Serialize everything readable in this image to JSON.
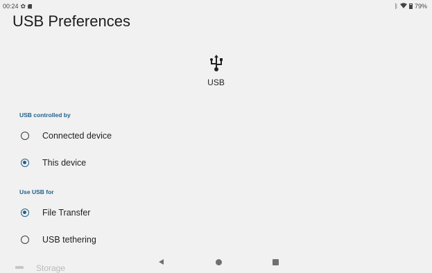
{
  "status": {
    "time": "00:24",
    "battery_percent": "79%",
    "icons_left": [
      "gear-icon",
      "sdcard-icon"
    ],
    "icons_right": [
      "bluetooth-icon",
      "wifi-icon",
      "battery-icon"
    ]
  },
  "page": {
    "title": "USB Preferences"
  },
  "header": {
    "icon": "usb-icon",
    "label": "USB"
  },
  "sections": {
    "controlled_by": {
      "label": "USB controlled by",
      "options": [
        {
          "label": "Connected device",
          "checked": false
        },
        {
          "label": "This device",
          "checked": true
        }
      ]
    },
    "use_for": {
      "label": "Use USB for",
      "options": [
        {
          "label": "File Transfer",
          "checked": true
        },
        {
          "label": "USB tethering",
          "checked": false
        }
      ]
    }
  },
  "partial_item": {
    "label": "Storage"
  },
  "colors": {
    "accent": "#1f5f8b",
    "background": "#f1f1f1"
  }
}
